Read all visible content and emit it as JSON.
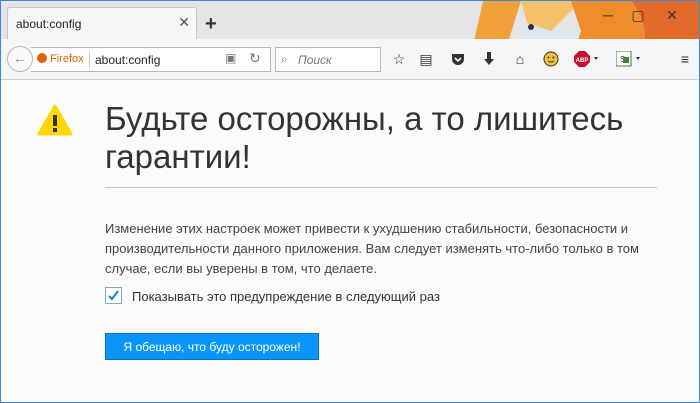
{
  "tab": {
    "title": "about:config",
    "close_glyph": "✕",
    "new_tab_glyph": "+"
  },
  "window_controls": {
    "minimize_glyph": "─",
    "maximize_glyph": "▢",
    "close_glyph": "✕"
  },
  "navbar": {
    "identity_label": "Firefox",
    "url": "about:config",
    "search_placeholder": "Поиск",
    "toolbar_icons": [
      "bookmark-star-icon",
      "reading-list-icon",
      "pocket-icon",
      "download-icon",
      "home-icon",
      "emoji-icon",
      "adblock-abp-icon",
      "translate-icon",
      "menu-icon"
    ]
  },
  "warning": {
    "title": "Будьте осторожны, а то лишитесь гарантии!",
    "description": "Изменение этих настроек может привести к ухудшению стабильности, безопасности и производительности данного приложения. Вам следует изменять что-либо только в том случае, если вы уверены в том, что делаете.",
    "checkbox_label": "Показывать это предупреждение в следующий раз",
    "checkbox_checked": true,
    "button_label": "Я обещаю, что буду осторожен!"
  },
  "colors": {
    "accent": "#0996f8",
    "warning": "#ffd800",
    "window_border": "#3b8ad7"
  }
}
